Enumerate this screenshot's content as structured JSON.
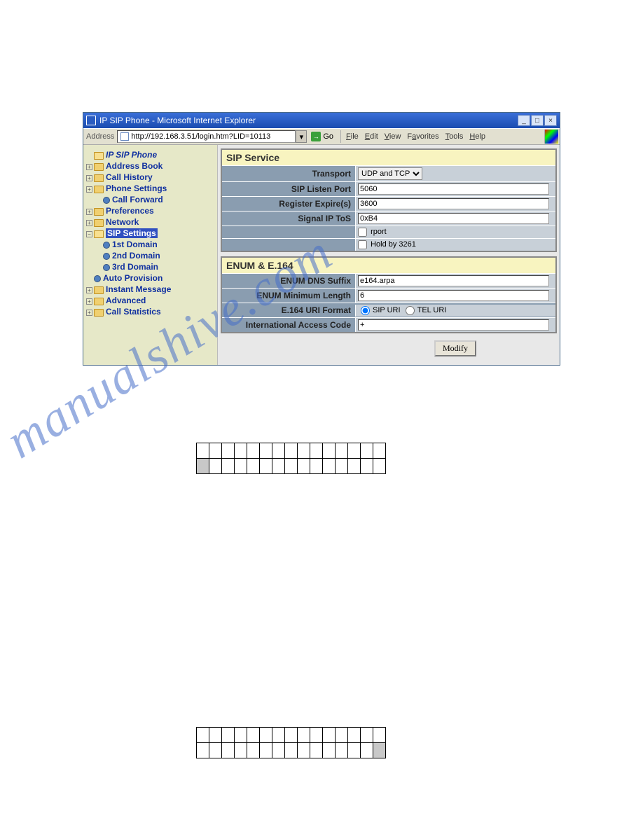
{
  "window": {
    "title": "IP SIP Phone - Microsoft Internet Explorer",
    "address_label": "Address",
    "url": "http://192.168.3.51/login.htm?LID=10113",
    "go_label": "Go",
    "menus": [
      "File",
      "Edit",
      "View",
      "Favorites",
      "Tools",
      "Help"
    ]
  },
  "tree": {
    "root": "IP SIP Phone",
    "items": [
      {
        "label": "Address Book",
        "expandable": true
      },
      {
        "label": "Call History",
        "expandable": true
      },
      {
        "label": "Phone Settings",
        "expandable": true,
        "children": [
          {
            "label": "Call Forward"
          }
        ]
      },
      {
        "label": "Preferences",
        "expandable": true
      },
      {
        "label": "Network",
        "expandable": true
      },
      {
        "label": "SIP Settings",
        "expandable": true,
        "open": true,
        "selected": true,
        "children": [
          {
            "label": "1st Domain"
          },
          {
            "label": "2nd Domain"
          },
          {
            "label": "3rd Domain"
          }
        ]
      },
      {
        "label": "Auto Provision"
      },
      {
        "label": "Instant Message",
        "expandable": true
      },
      {
        "label": "Advanced",
        "expandable": true
      },
      {
        "label": "Call Statistics",
        "expandable": true
      }
    ]
  },
  "panels": {
    "sip": {
      "title": "SIP Service",
      "transport_label": "Transport",
      "transport_value": "UDP and TCP",
      "listen_label": "SIP Listen Port",
      "listen_value": "5060",
      "expire_label": "Register Expire(s)",
      "expire_value": "3600",
      "tos_label": "Signal IP ToS",
      "tos_value": "0xB4",
      "rport_label": "rport",
      "hold_label": "Hold by 3261"
    },
    "enum": {
      "title": "ENUM & E.164",
      "dns_label": "ENUM DNS Suffix",
      "dns_value": "e164.arpa",
      "min_label": "ENUM Minimum Length",
      "min_value": "6",
      "uri_label": "E.164 URI Format",
      "uri_opt1": "SIP URI",
      "uri_opt2": "TEL URI",
      "intl_label": "International Access Code",
      "intl_value": "+"
    },
    "modify_btn": "Modify"
  },
  "watermark": "manualshive.com"
}
